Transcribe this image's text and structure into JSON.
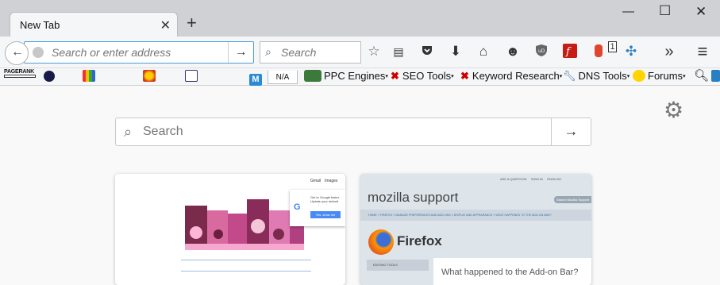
{
  "window": {
    "tab_title": "New Tab",
    "tab_close": "✕",
    "new_tab": "+",
    "minimize": "—",
    "maximize": "☐",
    "close": "✕"
  },
  "navbar": {
    "url_placeholder": "Search or enter address",
    "url_go": "→",
    "search_placeholder": "Search",
    "overflow": "»",
    "menu": "≡",
    "badge": "1"
  },
  "bookmarks": {
    "pagerank": "PAGERANK",
    "na": "N/A",
    "ppc": "PPC Engines",
    "seo": "SEO Tools",
    "keyword": "Keyword Research",
    "dns": "DNS Tools",
    "forums": "Forums"
  },
  "newtab": {
    "search_placeholder": "Search",
    "search_go": "→"
  },
  "tiles": {
    "google": {
      "gmail": "Gmail",
      "images": "Images",
      "promo_text": "Get to Google faster. Update your default search engine.",
      "promo_button": "Yes, show me"
    },
    "mozilla": {
      "top_links": [
        "ASK A QUESTION",
        "SIGN IN",
        "ENGLISH"
      ],
      "brand": "mozilla support",
      "search_placeholder": "Search Mozilla Support",
      "breadcrumb": "HOME » FIREFOX » MANAGE PREFERENCES AND ADD-ONS » DISPLAY AND APPEARANCE » WHAT HAPPENED TO THE ADD-ON BAR?",
      "product": "Firefox",
      "sidebar_label": "EDITING TOOLS",
      "article_title": "What happened to the Add-on Bar?"
    }
  },
  "colors": {
    "accent": "#4e9bd8",
    "titlebar": "#cfd1d4",
    "toolbar": "#f5f6f7",
    "page": "#f9f9fa"
  }
}
